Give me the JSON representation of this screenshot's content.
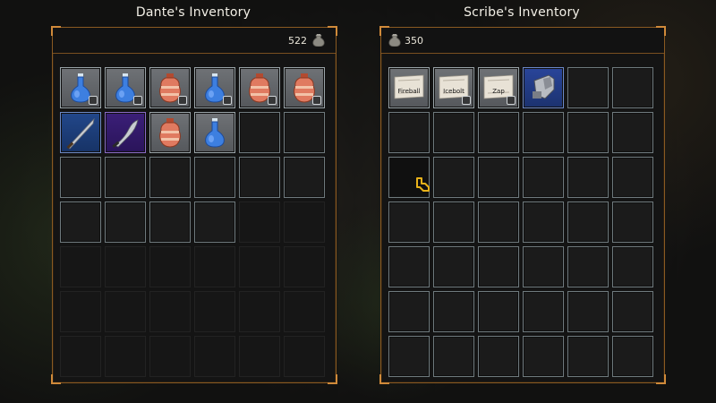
{
  "left_panel": {
    "title": "Dante's Inventory",
    "gold": "522",
    "slots": [
      {
        "item": "mana-potion-icon",
        "rarity": "common",
        "badge": true
      },
      {
        "item": "mana-potion-icon",
        "rarity": "common",
        "badge": true
      },
      {
        "item": "health-potion-icon",
        "rarity": "common",
        "badge": true
      },
      {
        "item": "mana-potion-icon",
        "rarity": "common",
        "badge": true
      },
      {
        "item": "health-potion-icon",
        "rarity": "common",
        "badge": true
      },
      {
        "item": "health-potion-icon",
        "rarity": "common",
        "badge": true
      },
      {
        "item": "sword-icon",
        "rarity": "blue"
      },
      {
        "item": "scimitar-icon",
        "rarity": "epic"
      },
      {
        "item": "health-potion-icon",
        "rarity": "common"
      },
      {
        "item": "mana-potion-icon",
        "rarity": "common"
      },
      {
        "item": null
      },
      {
        "item": null
      },
      {
        "item": null
      },
      {
        "item": null
      },
      {
        "item": null
      },
      {
        "item": null
      },
      {
        "item": null
      },
      {
        "item": null
      },
      {
        "item": null
      },
      {
        "item": null
      },
      {
        "item": null
      },
      {
        "item": null
      },
      {
        "item": "locked"
      },
      {
        "item": "locked"
      },
      {
        "item": "locked"
      },
      {
        "item": "locked"
      },
      {
        "item": "locked"
      },
      {
        "item": "locked"
      },
      {
        "item": "locked"
      },
      {
        "item": "locked"
      },
      {
        "item": "locked"
      },
      {
        "item": "locked"
      },
      {
        "item": "locked"
      },
      {
        "item": "locked"
      },
      {
        "item": "locked"
      },
      {
        "item": "locked"
      },
      {
        "item": "locked"
      },
      {
        "item": "locked"
      },
      {
        "item": "locked"
      },
      {
        "item": "locked"
      },
      {
        "item": "locked"
      },
      {
        "item": "locked"
      }
    ]
  },
  "right_panel": {
    "title": "Scribe's Inventory",
    "gold": "350",
    "slots": [
      {
        "item": "scroll-icon",
        "label": "Fireball",
        "rarity": "common"
      },
      {
        "item": "scroll-icon",
        "label": "Icebolt",
        "rarity": "common",
        "badge": true
      },
      {
        "item": "scroll-icon",
        "label": "Zap",
        "rarity": "common",
        "badge": true
      },
      {
        "item": "gauntlet-icon",
        "rarity": "rare"
      },
      {
        "item": null
      },
      {
        "item": null
      }
    ],
    "total_slots": 42,
    "hover_slot": 12
  },
  "colors": {
    "accent_gold": "#d08a3a",
    "common": "#6f7276",
    "rare": "#29459a",
    "epic": "#3b1f78"
  }
}
